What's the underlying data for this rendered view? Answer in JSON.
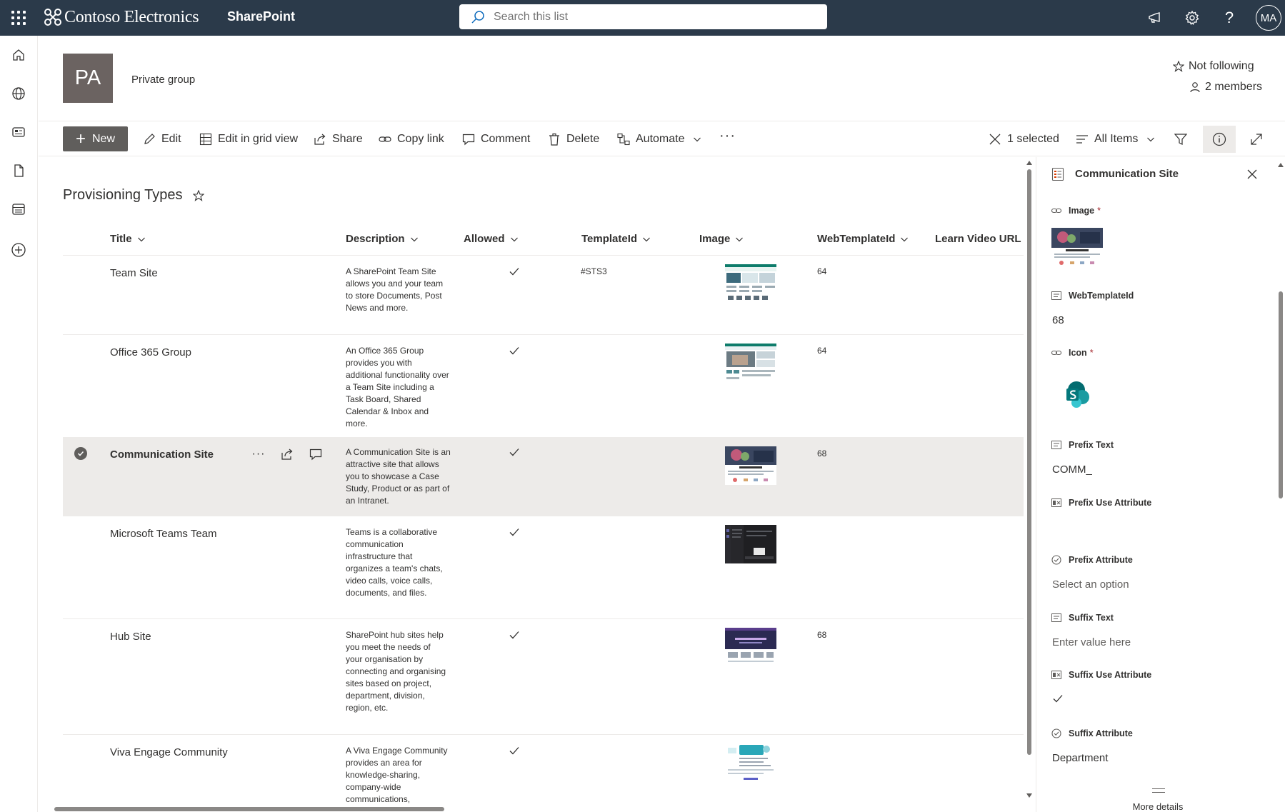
{
  "suitebar": {
    "brand": "Contoso Electronics",
    "app": "SharePoint",
    "search_placeholder": "Search this list",
    "user_initials": "MA"
  },
  "group": {
    "initials": "PA",
    "privacy": "Private group",
    "follow": "Not following",
    "members": "2 members"
  },
  "commands": {
    "new": "New",
    "edit": "Edit",
    "grid": "Edit in grid view",
    "share": "Share",
    "copy_link": "Copy link",
    "comment": "Comment",
    "delete": "Delete",
    "automate": "Automate",
    "selected": "1 selected",
    "view": "All Items"
  },
  "list": {
    "title": "Provisioning Types",
    "columns": [
      "Title",
      "Description",
      "Allowed",
      "TemplateId",
      "Image",
      "WebTemplateId",
      "Learn Video URL"
    ],
    "rows": [
      {
        "title": "Team Site",
        "desc": "A SharePoint Team Site allows you and your team to store Documents, Post News and more.",
        "allowed": true,
        "template": "#STS3",
        "webtpl": "64"
      },
      {
        "title": "Office 365 Group",
        "desc": "An Office 365 Group provides you with additional functionality over a Team Site including a Task Board, Shared Calendar & Inbox and more.",
        "allowed": true,
        "template": "",
        "webtpl": "64"
      },
      {
        "title": "Communication Site",
        "desc": "A Communication Site is an attractive site that allows you to showcase a Case Study, Product or as part of an Intranet.",
        "allowed": true,
        "template": "",
        "webtpl": "68",
        "selected": true
      },
      {
        "title": "Microsoft Teams Team",
        "desc": "Teams is a collaborative communication infrastructure that organizes a team's chats, video calls, voice calls, documents, and files.",
        "allowed": true,
        "template": "",
        "webtpl": ""
      },
      {
        "title": "Hub Site",
        "desc": "SharePoint hub sites help you meet the needs of your organisation by connecting and organising sites based on project, department, division, region, etc.",
        "allowed": true,
        "template": "",
        "webtpl": "68"
      },
      {
        "title": "Viva Engage Community",
        "desc": "A Viva Engage Community provides an area for knowledge-sharing, company-wide communications,",
        "allowed": true,
        "template": "",
        "webtpl": ""
      }
    ]
  },
  "pane": {
    "title": "Communication Site",
    "fields": {
      "image": "Image",
      "webtemplateid": "WebTemplateId",
      "webtemplateid_value": "68",
      "icon": "Icon",
      "prefix_text": "Prefix Text",
      "prefix_text_value": "COMM_",
      "prefix_use": "Prefix Use Attribute",
      "prefix_attr": "Prefix Attribute",
      "prefix_attr_value": "Select an option",
      "suffix_text": "Suffix Text",
      "suffix_text_value": "Enter value here",
      "suffix_use": "Suffix Use Attribute",
      "suffix_attr": "Suffix Attribute",
      "suffix_attr_value": "Department",
      "required_mark": "*"
    },
    "more_details": "More details"
  },
  "colors": {
    "suitebar": "#2b3a4a",
    "selected_row": "#edebe9",
    "required": "#a4262c",
    "sharepoint_teal": "#038387"
  }
}
